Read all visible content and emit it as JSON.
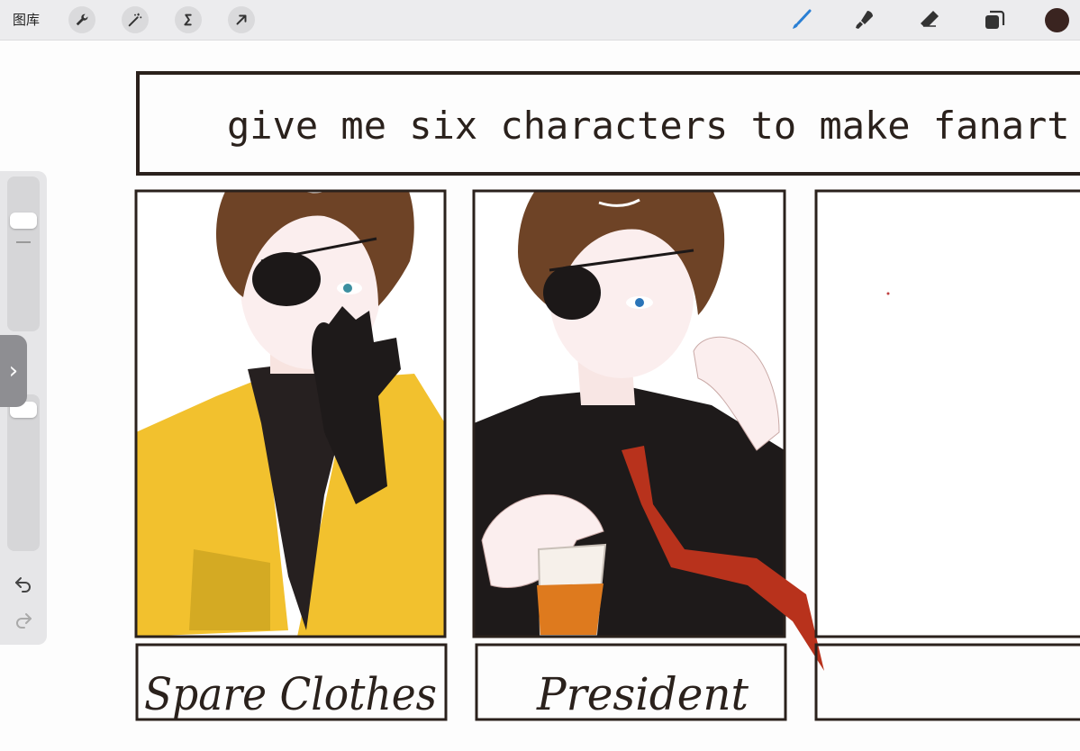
{
  "toolbar": {
    "gallery_label": "图库",
    "tools": [
      "wrench",
      "magic-wand",
      "selection",
      "transform"
    ],
    "right_tools": [
      "brush",
      "smudge",
      "eraser",
      "layers"
    ],
    "current_color": "#3a2420",
    "brush_color": "#2a7fd4"
  },
  "artwork": {
    "title": "give me six characters to make fanart of!",
    "panels": [
      {
        "label": "Spare Clothes",
        "jacket_color": "#f2c12e"
      },
      {
        "label": "President",
        "tie_color": "#b8321c"
      },
      {
        "label": ""
      }
    ]
  },
  "sidebar": {
    "undo": "undo",
    "redo": "redo"
  }
}
